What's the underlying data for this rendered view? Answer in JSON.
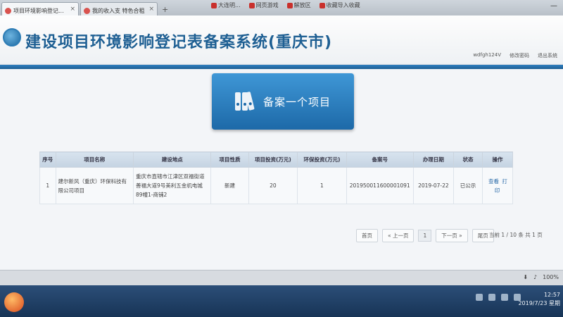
{
  "browser": {
    "tabs": [
      {
        "label": "项目环境影响登记..."
      },
      {
        "label": "我的收入支 特色合租"
      }
    ],
    "new_tab": "+",
    "bookmarks": [
      "大连明...",
      "网页游戏",
      "解放区",
      "收藏导入收藏"
    ],
    "window_controls": "—"
  },
  "header": {
    "title": "建设项目环境影响登记表备案系统(重庆市)",
    "user": "wdfgh124V",
    "change_password": "修改密码",
    "logout": "退出系统"
  },
  "main_button": {
    "label": "备案一个项目"
  },
  "table": {
    "headers": [
      "序号",
      "项目名称",
      "建设地点",
      "项目性质",
      "项目投资(万元)",
      "环保投资(万元)",
      "备案号",
      "办理日期",
      "状态",
      "操作"
    ],
    "rows": [
      {
        "index": "1",
        "name": "建尔新风（重庆）环保科技有限公司项目",
        "location": "重庆市直辖市江津区双福街道善福大道9号美利五金机电城89幢1-商铺2",
        "nature": "新建",
        "investment": "20",
        "env_investment": "1",
        "record_no": "201950011600001091",
        "date": "2019-07-22",
        "status": "已公示",
        "op_view": "查看",
        "op_print": "打印"
      }
    ]
  },
  "pagination": {
    "first": "首页",
    "prev": "« 上一页",
    "current": "1",
    "next": "下一页 »",
    "last": "尾页",
    "info": "当前 1 / 10 条 共 1 页"
  },
  "status_bar": {
    "zoom": "100%"
  },
  "taskbar": {
    "time": "12:57",
    "date": "2019/7/23 星期"
  }
}
